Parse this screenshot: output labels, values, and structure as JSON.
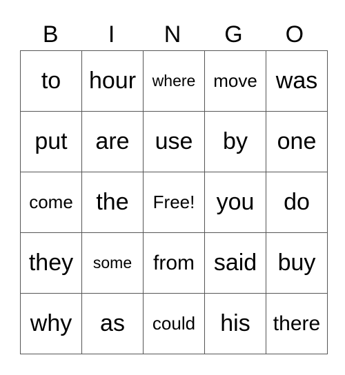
{
  "header": [
    "B",
    "I",
    "N",
    "G",
    "O"
  ],
  "rows": [
    [
      "to",
      "hour",
      "where",
      "move",
      "was"
    ],
    [
      "put",
      "are",
      "use",
      "by",
      "one"
    ],
    [
      "come",
      "the",
      "Free!",
      "you",
      "do"
    ],
    [
      "they",
      "some",
      "from",
      "said",
      "buy"
    ],
    [
      "why",
      "as",
      "could",
      "his",
      "there"
    ]
  ]
}
